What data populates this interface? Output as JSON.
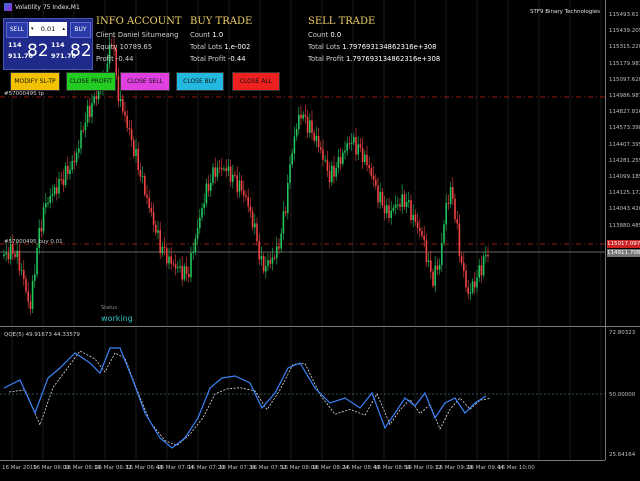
{
  "window": {
    "symbol": "Volatility 75 Index,M1",
    "brand": "STF9 Binary Technologies"
  },
  "trade_panel": {
    "sell_label": "SELL",
    "buy_label": "BUY",
    "lot": "0.01",
    "sell_quote": {
      "prefix": "114",
      "middle": "911.70",
      "big": "82"
    },
    "buy_quote": {
      "prefix": "114",
      "middle": "971.70",
      "big": "82"
    }
  },
  "info_account": {
    "title": "INFO ACCOUNT",
    "client": "Client Daniel Situmeang",
    "equity": "Equity 10789.65",
    "profit": "Profit -0.44"
  },
  "buy_trade": {
    "title": "BUY TRADE",
    "count_label": "Count",
    "count": "1.0",
    "lots_label": "Total Lots",
    "lots": "1.e-002",
    "profit_label": "Total Profit",
    "profit": "-0.44"
  },
  "sell_trade": {
    "title": "SELL TRADE",
    "count_label": "Count",
    "count": "0.0",
    "lots_label": "Total Lots",
    "lots": "1.797693134862316e+308",
    "profit_label": "Total Profit",
    "profit": "1.797693134862316e+308"
  },
  "actions": [
    {
      "label": "MODIFY SL-TP",
      "color": "#f2c200"
    },
    {
      "label": "CLOSE PROFIT",
      "color": "#22cc22"
    },
    {
      "label": "CLOSE SELL",
      "color": "#e040e0"
    },
    {
      "label": "CLOSE BUY",
      "color": "#22b8e0"
    },
    {
      "label": "CLOSE ALL",
      "color": "#ee2020"
    }
  ],
  "status": {
    "label": "Status",
    "value": "working"
  },
  "line_labels": {
    "sl": "#57000495 tp",
    "entry": "#57000495 buy 0.01"
  },
  "price_axis": {
    "ticks": [
      "115493.61",
      "115439.2050",
      "115315.2205",
      "115179.9830",
      "115097.6200",
      "114986.9870",
      "114827.8160",
      "114573.3980",
      "114407.3950",
      "114281.2550",
      "114099.1850",
      "114125.1720",
      "114043.4260",
      "113880.4855",
      "113692.6360",
      "113518.0060",
      "113340.8200",
      "113185.1800",
      "112999.1080"
    ],
    "tags": [
      {
        "text": "115017.0970",
        "color": "#cc2222"
      },
      {
        "text": "114911.7082",
        "color": "#777777"
      }
    ]
  },
  "qqe": {
    "title": "QQE(5) 49.91673 44.33579",
    "axis": [
      "72.80323",
      "50.00000",
      "25.64164"
    ]
  },
  "time_axis": [
    "16 Mar 2019",
    "16 Mar 06:00",
    "16 Mar 06:16",
    "16 Mar 06:32",
    "16 Mar 06:48",
    "16 Mar 07:04",
    "16 Mar 07:20",
    "16 Mar 07:36",
    "16 Mar 07:52",
    "16 Mar 08:08",
    "16 Mar 08:24",
    "16 Mar 08:40",
    "16 Mar 08:56",
    "16 Mar 09:12",
    "16 Mar 09:28",
    "16 Mar 09:44",
    "16 Mar 10:00"
  ],
  "colors": {
    "bull": "#22c55e",
    "bear": "#ef4444",
    "qqe_fast": "#3b82f6",
    "qqe_slow": "#e0e0e0",
    "red_line": "#cc2222",
    "entry_line": "#888888"
  }
}
